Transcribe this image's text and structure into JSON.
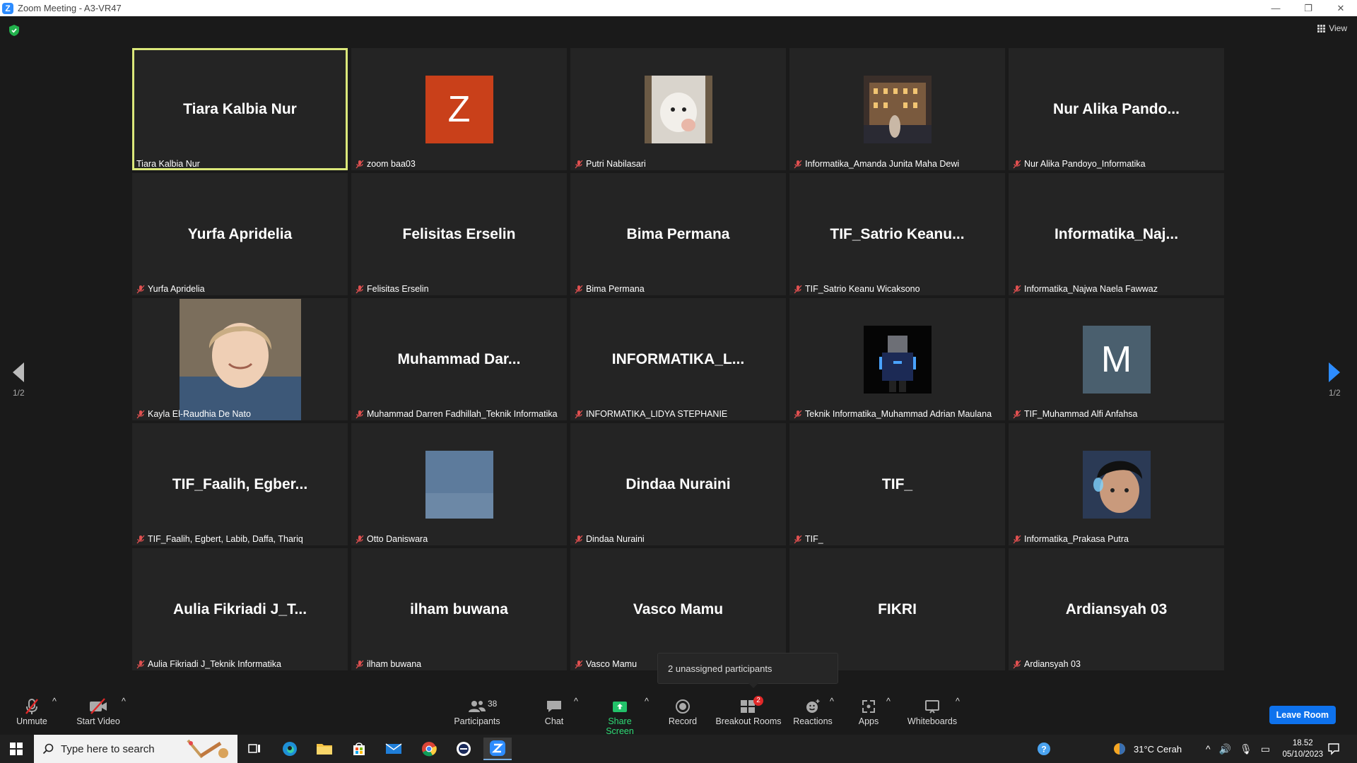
{
  "window": {
    "title": "Zoom Meeting - A3-VR47",
    "controls": [
      "—",
      "❐",
      "✕"
    ]
  },
  "header": {
    "view_label": "View"
  },
  "tiles": [
    {
      "big": "Tiara Kalbia Nur",
      "label": "Tiara Kalbia Nur",
      "muted": false,
      "active": true
    },
    {
      "big": "",
      "label": "zoom baa03",
      "muted": true,
      "avatar": "letter",
      "letter": "Z",
      "color": "#c9401a"
    },
    {
      "big": "",
      "label": "Putri Nabilasari",
      "muted": true,
      "avatar": "cat-photo"
    },
    {
      "big": "",
      "label": "Informatika_Amanda Junita Maha Dewi",
      "muted": true,
      "avatar": "building-photo"
    },
    {
      "big": "Nur Alika Pando...",
      "label": "Nur Alika Pandoyo_Informatika",
      "muted": true
    },
    {
      "big": "Yurfa Apridelia",
      "label": "Yurfa Apridelia",
      "muted": true
    },
    {
      "big": "Felisitas Erselin",
      "label": "Felisitas Erselin",
      "muted": true
    },
    {
      "big": "Bima Permana",
      "label": "Bima Permana",
      "muted": true
    },
    {
      "big": "TIF_Satrio  Keanu...",
      "label": "TIF_Satrio Keanu Wicaksono",
      "muted": true
    },
    {
      "big": "Informatika_Naj...",
      "label": "Informatika_Najwa Naela Fawwaz",
      "muted": true
    },
    {
      "big": "",
      "label": "Kayla El-Raudhia De Nato",
      "muted": true,
      "avatar": "person-photo"
    },
    {
      "big": "Muhammad  Dar...",
      "label": "Muhammad Darren Fadhillah_Teknik Informatika",
      "muted": true
    },
    {
      "big": "INFORMATIKA_L...",
      "label": "INFORMATIKA_LIDYA STEPHANIE",
      "muted": true
    },
    {
      "big": "",
      "label": "Teknik Informatika_Muhammad Adrian Maulana",
      "muted": true,
      "avatar": "game-photo"
    },
    {
      "big": "",
      "label": "TIF_Muhammad Alfi Anfahsa",
      "muted": true,
      "avatar": "letter",
      "letter": "M",
      "color": "#4a5f6e"
    },
    {
      "big": "TIF_Faalih,  Egber...",
      "label": "TIF_Faalih, Egbert, Labib, Daffa, Thariq",
      "muted": true
    },
    {
      "big": "",
      "label": "Otto Daniswara",
      "muted": true,
      "avatar": "sky-photo"
    },
    {
      "big": "Dindaa Nuraini",
      "label": "Dindaa Nuraini",
      "muted": true
    },
    {
      "big": "TIF_",
      "label": "TIF_",
      "muted": true
    },
    {
      "big": "",
      "label": "Informatika_Prakasa Putra",
      "muted": true,
      "avatar": "face-photo"
    },
    {
      "big": "Aulia Fikriadi J_T...",
      "label": "Aulia Fikriadi J_Teknik Informatika",
      "muted": true
    },
    {
      "big": "ilham buwana",
      "label": "ilham buwana",
      "muted": true
    },
    {
      "big": "Vasco Mamu",
      "label": "Vasco Mamu",
      "muted": true
    },
    {
      "big": "FIKRI",
      "label": "",
      "muted": false
    },
    {
      "big": "Ardiansyah 03",
      "label": "Ardiansyah 03",
      "muted": true
    }
  ],
  "pager": {
    "left": "1/2",
    "right": "1/2"
  },
  "popover": {
    "text": "2 unassigned participants"
  },
  "toolbar": {
    "unmute": "Unmute",
    "start_video": "Start Video",
    "participants": "Participants",
    "participants_count": "38",
    "chat": "Chat",
    "share_screen": "Share Screen",
    "record": "Record",
    "breakout_rooms": "Breakout Rooms",
    "breakout_badge": "2",
    "reactions": "Reactions",
    "apps": "Apps",
    "whiteboards": "Whiteboards",
    "leave": "Leave Room"
  },
  "taskbar": {
    "search_placeholder": "Type here to search",
    "weather": "31°C  Cerah",
    "time": "18.52",
    "date": "05/10/2023"
  }
}
